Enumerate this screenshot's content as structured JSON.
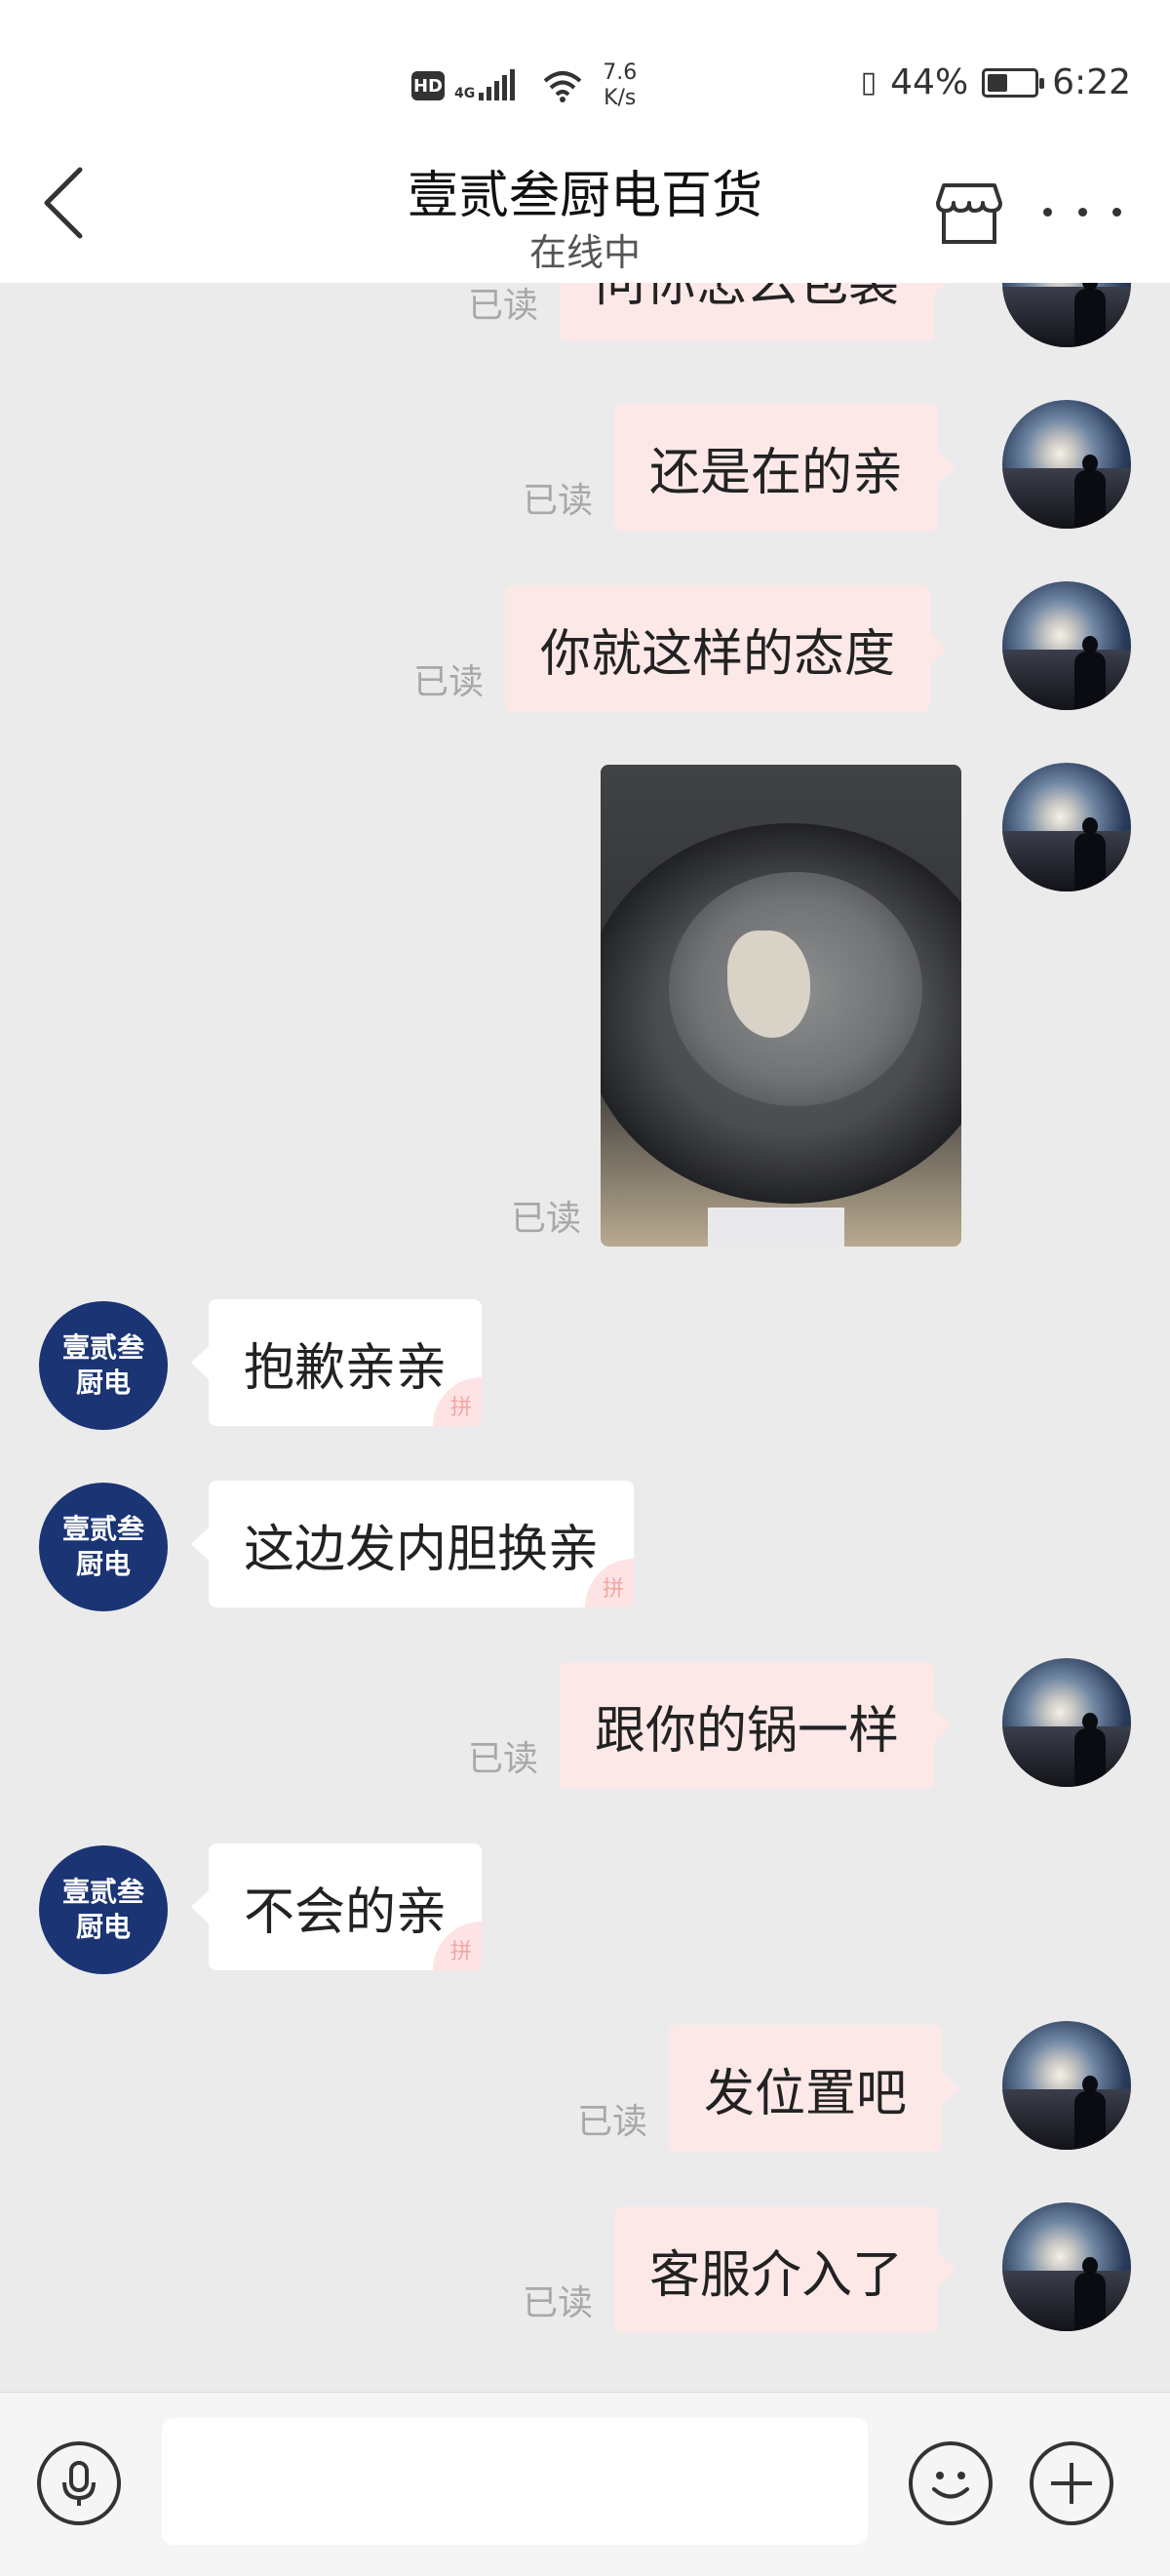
{
  "status_bar": {
    "hd": "HD",
    "network": "4G",
    "speed_value": "7.6",
    "speed_unit": "K/s",
    "battery": "44%",
    "battery_level": 0.44,
    "time": "6:22"
  },
  "header": {
    "title": "壹贰叁厨电百货",
    "subtitle": "在线中"
  },
  "shop_avatar": {
    "line1": "壹贰叁",
    "line2": "厨电"
  },
  "read_label": "已读",
  "messages": [
    {
      "side": "out",
      "text": "问你怎么包装",
      "read": "已读"
    },
    {
      "side": "out",
      "text": "还是在的亲",
      "read": "已读"
    },
    {
      "side": "out",
      "text": "你就这样的态度",
      "read": "已读"
    },
    {
      "side": "out",
      "type": "image",
      "read": "已读"
    },
    {
      "side": "in",
      "text": "抱歉亲亲"
    },
    {
      "side": "in",
      "text": "这边发内胆换亲"
    },
    {
      "side": "out",
      "text": "跟你的锅一样",
      "read": "已读"
    },
    {
      "side": "in",
      "text": "不会的亲"
    },
    {
      "side": "out",
      "text": "发位置吧",
      "read": "已读"
    },
    {
      "side": "out",
      "text": "客服介入了",
      "read": "已读"
    }
  ],
  "pin_mark": "拼",
  "input": {
    "placeholder": "",
    "value": ""
  },
  "colors": {
    "outgoing_bubble": "#fde8e8",
    "incoming_bubble": "#ffffff",
    "chat_background": "#ebebeb",
    "shop_avatar": "#1b3474"
  },
  "icons": [
    "back-icon",
    "shop-icon",
    "more-icon",
    "mic-icon",
    "emoji-icon",
    "plus-icon"
  ]
}
